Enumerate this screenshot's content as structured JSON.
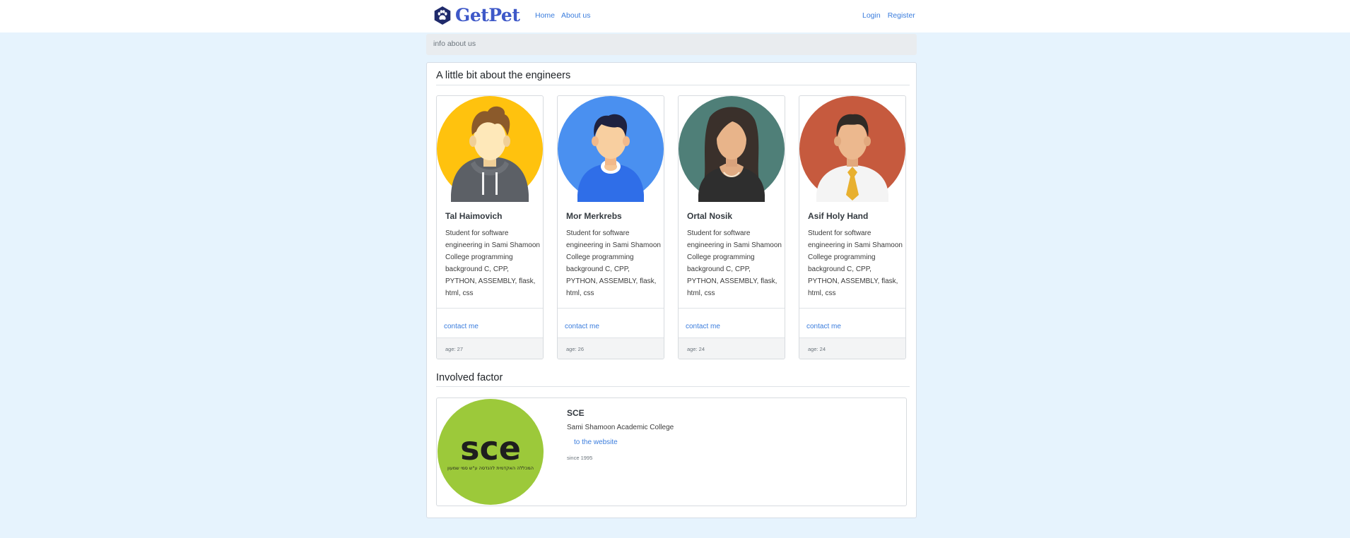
{
  "nav": {
    "brand": "GetPet",
    "links": [
      "Home",
      "About us"
    ],
    "auth": [
      "Login",
      "Register"
    ]
  },
  "info_bar": "info about us",
  "engineers_section": {
    "title": "A little bit about the engineers",
    "people": [
      {
        "name": "Tal Haimovich",
        "description": "Student for software engineering in Sami Shamoon College programming background C, CPP, PYTHON, ASSEMBLY, flask, html, css",
        "contact": "contact me",
        "age": "age: 27",
        "avatar_bg": "#ffc20e"
      },
      {
        "name": "Mor Merkrebs",
        "description": "Student for software engineering in Sami Shamoon College programming background C, CPP, PYTHON, ASSEMBLY, flask, html, css",
        "contact": "contact me",
        "age": "age: 26",
        "avatar_bg": "#4a90f0"
      },
      {
        "name": "Ortal Nosik",
        "description": "Student for software engineering in Sami Shamoon College programming background C, CPP, PYTHON, ASSEMBLY, flask, html, css",
        "contact": "contact me",
        "age": "age: 24",
        "avatar_bg": "#4f7f78"
      },
      {
        "name": "Asif Holy Hand",
        "description": "Student for software engineering in Sami Shamoon College programming background C, CPP, PYTHON, ASSEMBLY, flask, html, css",
        "contact": "contact me",
        "age": "age: 24",
        "avatar_bg": "#c65a3e"
      }
    ]
  },
  "factor_section": {
    "title": "Involved factor",
    "org": {
      "name": "SCE",
      "description": "Sami Shamoon Academic College",
      "link": "to the website",
      "since": "since 1995",
      "logo_text": "sce",
      "logo_subtext": "המכללה האקדמית להנדסה ע\"ש סמי שמעון",
      "logo_bg": "#9cc93a"
    }
  },
  "colors": {
    "page_bg": "#e6f3fd",
    "link": "#3b7ddd",
    "brand": "#3e58c8"
  }
}
